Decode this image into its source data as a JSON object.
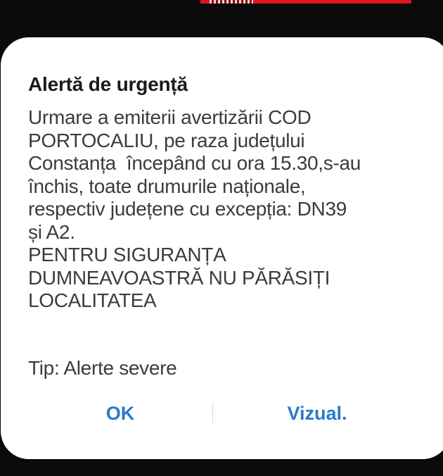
{
  "alert": {
    "title": "Alertă de urgență",
    "message_lines": [
      "Urmare a emiterii avertizării COD",
      "PORTOCALIU, pe raza județului",
      "Constanța  începând cu ora 15.30,s-au",
      "închis, toate drumurile naționale,",
      "respectiv județene cu excepția: DN39",
      "și A2.",
      "PENTRU SIGURANȚA",
      "DUMNEAVOASTRĂ NU PĂRĂSIȚI",
      "LOCALITATEA"
    ],
    "type_label": "Tip: Alerte severe"
  },
  "buttons": {
    "ok_label": "OK",
    "view_label": "Vizual."
  },
  "colors": {
    "accent": "#2a79c8",
    "background": "#0b0b0b",
    "dialog": "#ffffff",
    "top_strip": "#e0141c"
  }
}
